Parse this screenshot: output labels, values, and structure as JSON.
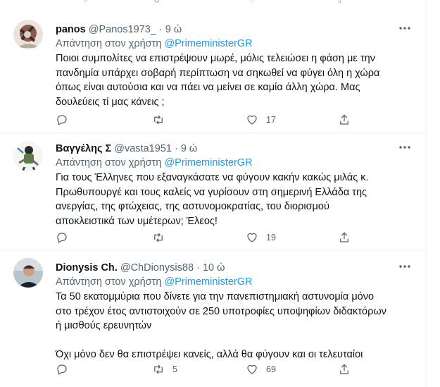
{
  "tweets": [
    {
      "name": "panos",
      "handle": "@Panos1973_",
      "time": "9 ώ",
      "reply_prefix": "Απάντηση στον χρήστη",
      "reply_to": "@PrimeministerGR",
      "lines": [
        "Ποιοι συμπολίτες να επιστρέψουν μωρέ,  μόλις τελειώσει η φάση με την",
        "πανδημία υπάρχει σοβαρή περίπτωση να σηκωθεί να φύγει όλη η χώρα",
        "όπως είναι αυτούσια και να πάει να μείνει σε καμία άλλη χώρα. Μας",
        "δουλεύεις τί μας κάνεις ;"
      ],
      "reply_count": "",
      "retweet_count": "",
      "like_count": "17"
    },
    {
      "name": "Βαγγέλης Σ",
      "handle": "@vasta1951",
      "time": "9 ώ",
      "reply_prefix": "Απάντηση στον χρήστη",
      "reply_to": "@PrimeministerGR",
      "lines": [
        "Για τους Έλληνες που εξαναγκάσατε να φύγουν κακήν κακώς μιλάς κ.",
        "Πρωθυπουργέ και τους καλείς να γυρίσουν στη σημερινή Ελλάδα της",
        "ανεργίας, της φτώχειας, της αστυνομοκρατίας, του διορισμού",
        "αποκλειστικά των υμέτερων; Έλεος!"
      ],
      "reply_count": "",
      "retweet_count": "",
      "like_count": "19"
    },
    {
      "name": "Dionysis Ch.",
      "handle": "@ChDionysis88",
      "time": "10 ώ",
      "reply_prefix": "Απάντηση στον χρήστη",
      "reply_to": "@PrimeministerGR",
      "lines": [
        "Τα 50 εκατομμύρια που δίνετε για την πανεπιστημιακή αστυνομία μόνο",
        "στο τρέχον έτος αντιστοιχούν σε 250 υποτροφίες υποψηφίων διδακτόρων",
        "ή μισθούς ερευνητών",
        "",
        "Όχι μόνο δεν θα επιστρέψει κανείς, αλλά θα φύγουν και οι τελευταίοι"
      ],
      "reply_count": "",
      "retweet_count": "5",
      "like_count": "69"
    }
  ],
  "colors": {
    "text": "#0f1419",
    "secondary": "#536471",
    "accent": "#1d9bf0",
    "divider": "#eff3f4"
  },
  "icons": {
    "reply": "reply-icon",
    "retweet": "retweet-icon",
    "like": "heart-icon",
    "share": "share-icon",
    "more": "more-icon"
  }
}
